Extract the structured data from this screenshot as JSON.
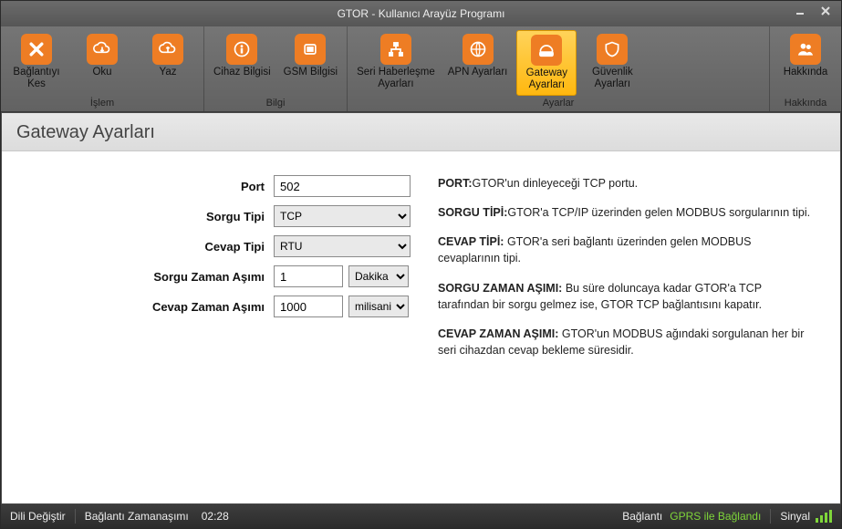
{
  "window": {
    "title": "GTOR - Kullanıcı Arayüz Programı"
  },
  "ribbon": {
    "groups": [
      {
        "label": "İşlem",
        "items": [
          {
            "id": "disconnect",
            "label": "Bağlantıyı\nKes"
          },
          {
            "id": "read",
            "label": "Oku"
          },
          {
            "id": "write",
            "label": "Yaz"
          }
        ]
      },
      {
        "label": "Bilgi",
        "items": [
          {
            "id": "device-info",
            "label": "Cihaz Bilgisi"
          },
          {
            "id": "gsm-info",
            "label": "GSM Bilgisi"
          }
        ]
      },
      {
        "label": "Ayarlar",
        "items": [
          {
            "id": "serial-settings",
            "label": "Seri Haberleşme\nAyarları"
          },
          {
            "id": "apn-settings",
            "label": "APN Ayarları"
          },
          {
            "id": "gateway-settings",
            "label": "Gateway\nAyarları",
            "active": true
          },
          {
            "id": "security-settings",
            "label": "Güvenlik\nAyarları"
          }
        ]
      },
      {
        "label": "Hakkında",
        "items": [
          {
            "id": "about",
            "label": "Hakkında"
          }
        ]
      }
    ]
  },
  "page": {
    "title": "Gateway Ayarları",
    "form": {
      "port_label": "Port",
      "port_value": "502",
      "query_type_label": "Sorgu Tipi",
      "query_type_value": "TCP",
      "response_type_label": "Cevap Tipi",
      "response_type_value": "RTU",
      "query_timeout_label": "Sorgu Zaman Aşımı",
      "query_timeout_value": "1",
      "query_timeout_unit": "Dakika",
      "response_timeout_label": "Cevap Zaman Aşımı",
      "response_timeout_value": "1000",
      "response_timeout_unit": "milisani..."
    },
    "help": {
      "p1_b": "PORT:",
      "p1_t": "GTOR'un dinleyeceği TCP portu.",
      "p2_b": "SORGU TİPİ:",
      "p2_t": "GTOR'a TCP/IP üzerinden gelen MODBUS sorgularının tipi.",
      "p3_b": "CEVAP TİPİ:",
      "p3_t": " GTOR'a seri bağlantı üzerinden gelen MODBUS cevaplarının tipi.",
      "p4_b": "SORGU ZAMAN AŞIMI:",
      "p4_t": " Bu süre doluncaya kadar GTOR'a TCP tarafından bir sorgu gelmez ise, GTOR TCP bağlantısını kapatır.",
      "p5_b": "CEVAP ZAMAN AŞIMI:",
      "p5_t": " GTOR'un MODBUS ağındaki sorgulanan her bir seri cihazdan cevap bekleme süresidir."
    }
  },
  "status": {
    "lang": "Dili Değiştir",
    "timeout_label": "Bağlantı Zamanaşımı",
    "timeout_value": "02:28",
    "conn_label": "Bağlantı",
    "conn_value": "GPRS ile Bağlandı",
    "signal_label": "Sinyal"
  }
}
